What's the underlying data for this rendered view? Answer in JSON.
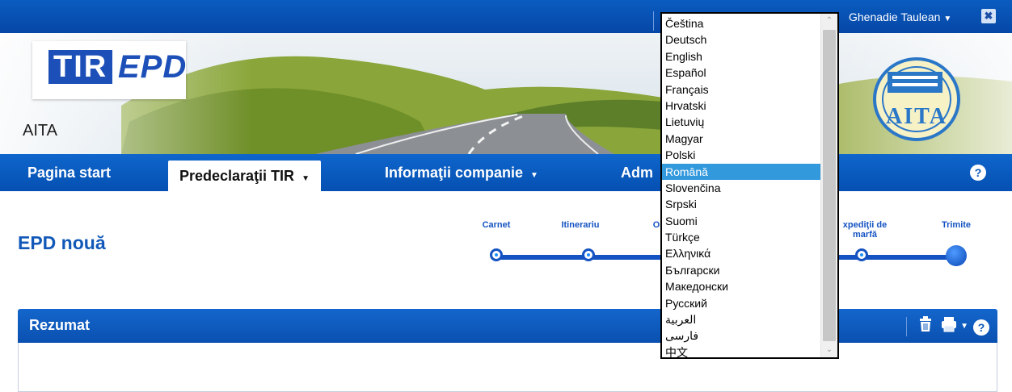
{
  "app": {
    "logo": {
      "tir": "TIR",
      "epd": "EPD"
    },
    "company": "AITA",
    "partner_logo_text": "AITA",
    "user": "Ghenadie Taulean",
    "close_symbol": "✖",
    "caret": "▼",
    "help_symbol": "?"
  },
  "nav": {
    "items": [
      "Pagina start",
      "Predeclaraţii TIR",
      "Informaţii companie",
      "Adm"
    ],
    "active_index": 1
  },
  "page": {
    "title": "EPD nouă"
  },
  "wizard": {
    "steps": [
      "Carnet",
      "Itinerariu",
      "O",
      "xpediţii de marfă",
      "Trimite"
    ]
  },
  "panel": {
    "title": "Rezumat"
  },
  "language_dropdown": {
    "options": [
      "Čeština",
      "Deutsch",
      "English",
      "Español",
      "Français",
      "Hrvatski",
      "Lietuvių",
      "Magyar",
      "Polski",
      "Română",
      "Slovenčina",
      "Srpski",
      "Suomi",
      "Türkçe",
      "Ελληνικά",
      "Български",
      "Македонски",
      "Русский",
      "العربية",
      "فارسی",
      "中文"
    ],
    "selected": "Română"
  },
  "colors": {
    "primary": "#0a57b8",
    "title": "#1158b8",
    "selection": "#3399dd"
  }
}
